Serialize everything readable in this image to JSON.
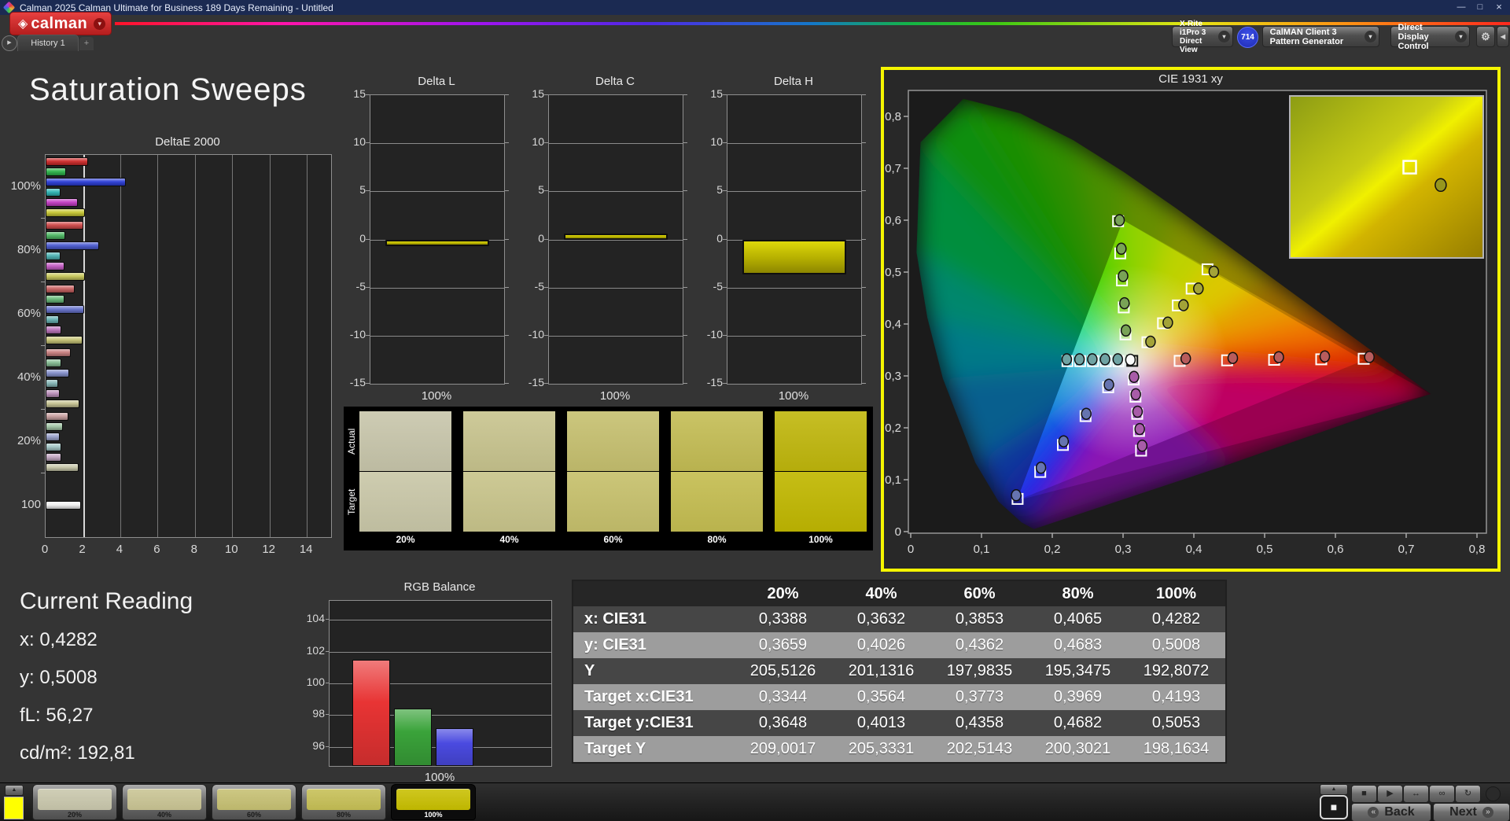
{
  "window": {
    "title": "Calman 2025 Calman Ultimate for Business 189 Days Remaining  - Untitled",
    "minimize": "—",
    "maximize": "□",
    "close": "×"
  },
  "brand": {
    "logo_glyph": "◈",
    "logo_text": "calman",
    "dropdown_glyph": "▾"
  },
  "history_bar": {
    "expand_glyph": "▶",
    "tab_label": "History 1",
    "add_tab_label": "+"
  },
  "toolbar": {
    "meter": {
      "line1": "X-Rite i1Pro 3",
      "line2": "Direct View",
      "stripe_color": "#2ed22e"
    },
    "meter_badge": "714",
    "pattern": {
      "label": "CalMAN Client 3 Pattern Generator",
      "stripe_color": "#2ed22e"
    },
    "display": {
      "label": "Direct Display Control",
      "stripe_color": "#e8e400"
    },
    "gear_glyph": "⚙",
    "collapse_glyph": "◀",
    "dropdown_glyph": "▾"
  },
  "page_title": "Saturation Sweeps",
  "current_reading": {
    "title": "Current Reading",
    "lines": [
      "x: 0,4282",
      "y: 0,5008",
      "fL: 56,27",
      "cd/m²: 192,81"
    ]
  },
  "swatch_panel": {
    "row_labels": [
      "Actual",
      "Target"
    ],
    "columns": [
      {
        "label": "20%",
        "actual": "#c8c6ab",
        "target": "#cac8a9"
      },
      {
        "label": "40%",
        "actual": "#c8c48e",
        "target": "#c9c58c"
      },
      {
        "label": "60%",
        "actual": "#c6c06f",
        "target": "#c7c16d"
      },
      {
        "label": "80%",
        "actual": "#c4bd54",
        "target": "#c5be52"
      },
      {
        "label": "100%",
        "actual": "#c0b70c",
        "target": "#c1b802"
      }
    ]
  },
  "table": {
    "headers": [
      "",
      "20%",
      "40%",
      "60%",
      "80%",
      "100%"
    ],
    "rows": [
      {
        "label": "x: CIE31",
        "values": [
          "0,3388",
          "0,3632",
          "0,3853",
          "0,4065",
          "0,4282"
        ]
      },
      {
        "label": "y: CIE31",
        "values": [
          "0,3659",
          "0,4026",
          "0,4362",
          "0,4683",
          "0,5008"
        ]
      },
      {
        "label": "Y",
        "values": [
          "205,5126",
          "201,1316",
          "197,9835",
          "195,3475",
          "192,8072"
        ]
      },
      {
        "label": "Target x:CIE31",
        "values": [
          "0,3344",
          "0,3564",
          "0,3773",
          "0,3969",
          "0,4193"
        ]
      },
      {
        "label": "Target y:CIE31",
        "values": [
          "0,3648",
          "0,4013",
          "0,4358",
          "0,4682",
          "0,5053"
        ]
      },
      {
        "label": "Target Y",
        "values": [
          "209,0017",
          "205,3331",
          "202,5143",
          "200,3021",
          "198,1634"
        ]
      }
    ]
  },
  "bottom_bar": {
    "up_glyph": "▲",
    "pattern_swatch_color": "#ffff00",
    "swatches": [
      {
        "label": "20%",
        "color": "#c9c7ac",
        "selected": false
      },
      {
        "label": "40%",
        "color": "#c9c493",
        "selected": false
      },
      {
        "label": "60%",
        "color": "#c6c072",
        "selected": false
      },
      {
        "label": "80%",
        "color": "#c6bf55",
        "selected": false
      },
      {
        "label": "100%",
        "color": "#c8bf00",
        "selected": true
      }
    ],
    "transport_buttons": [
      {
        "name": "stop",
        "glyph": "■"
      },
      {
        "name": "play",
        "glyph": "▶"
      },
      {
        "name": "step",
        "glyph": "↔"
      },
      {
        "name": "continuous",
        "glyph": "∞"
      },
      {
        "name": "refresh",
        "glyph": "↻"
      }
    ],
    "stop_button_glyph": "■",
    "back_label": "Back",
    "back_glyph": "«",
    "next_label": "Next",
    "next_glyph": "»"
  },
  "chart_data": [
    {
      "id": "deltae2000",
      "type": "bar",
      "orientation": "horizontal",
      "title": "DeltaE 2000",
      "xlim": [
        0,
        15.3
      ],
      "xticks": [
        0,
        2,
        4,
        6,
        8,
        10,
        12,
        14
      ],
      "reference_line": 2,
      "groups": [
        {
          "label": "100%",
          "bars": [
            {
              "name": "red",
              "value": 2.3,
              "color": "#cf2a2a"
            },
            {
              "name": "green",
              "value": 1.15,
              "color": "#2cb44a"
            },
            {
              "name": "blue",
              "value": 4.35,
              "color": "#2a3cd8"
            },
            {
              "name": "cyan",
              "value": 0.85,
              "color": "#2cb4b4"
            },
            {
              "name": "magenta",
              "value": 1.75,
              "color": "#c43cc4"
            },
            {
              "name": "yellow",
              "value": 2.15,
              "color": "#c8c832"
            }
          ]
        },
        {
          "label": "80%",
          "bars": [
            {
              "name": "red",
              "value": 2.05,
              "color": "#cf4848"
            },
            {
              "name": "green",
              "value": 1.1,
              "color": "#4cb862"
            },
            {
              "name": "blue",
              "value": 2.9,
              "color": "#4a5ad2"
            },
            {
              "name": "cyan",
              "value": 0.85,
              "color": "#4cb4b4"
            },
            {
              "name": "magenta",
              "value": 1.05,
              "color": "#c45cc4"
            },
            {
              "name": "yellow",
              "value": 2.15,
              "color": "#c8c85a"
            }
          ]
        },
        {
          "label": "60%",
          "bars": [
            {
              "name": "red",
              "value": 1.6,
              "color": "#c96060"
            },
            {
              "name": "green",
              "value": 1.05,
              "color": "#66b878"
            },
            {
              "name": "blue",
              "value": 2.1,
              "color": "#6672cc"
            },
            {
              "name": "cyan",
              "value": 0.75,
              "color": "#66b2b2"
            },
            {
              "name": "magenta",
              "value": 0.9,
              "color": "#bc74bc"
            },
            {
              "name": "yellow",
              "value": 2.0,
              "color": "#c6c374"
            }
          ]
        },
        {
          "label": "40%",
          "bars": [
            {
              "name": "red",
              "value": 1.4,
              "color": "#c87e7e"
            },
            {
              "name": "green",
              "value": 0.9,
              "color": "#84bc92"
            },
            {
              "name": "blue",
              "value": 1.3,
              "color": "#8490cc"
            },
            {
              "name": "cyan",
              "value": 0.7,
              "color": "#84b6b6"
            },
            {
              "name": "magenta",
              "value": 0.8,
              "color": "#bc90bc"
            },
            {
              "name": "yellow",
              "value": 1.85,
              "color": "#c6c392"
            }
          ]
        },
        {
          "label": "20%",
          "bars": [
            {
              "name": "red",
              "value": 1.25,
              "color": "#c9a0a0"
            },
            {
              "name": "green",
              "value": 0.95,
              "color": "#a2c6a6"
            },
            {
              "name": "blue",
              "value": 0.8,
              "color": "#9aa2cc"
            },
            {
              "name": "cyan",
              "value": 0.9,
              "color": "#a2c6c6"
            },
            {
              "name": "magenta",
              "value": 0.9,
              "color": "#c2a6c2"
            },
            {
              "name": "yellow",
              "value": 1.8,
              "color": "#c6c6a8"
            }
          ]
        },
        {
          "label": "100",
          "bars": [
            {
              "name": "white",
              "value": 1.95,
              "color": "#f0f0f0"
            }
          ]
        }
      ]
    },
    {
      "id": "delta_l",
      "type": "bar",
      "title": "Delta L",
      "categories": [
        "100%"
      ],
      "values": [
        -0.6
      ],
      "ylim": [
        -15,
        15
      ],
      "yticks": [
        15,
        10,
        5,
        0,
        -5,
        -10,
        -15
      ],
      "xlabel": "100%",
      "bar_color": "#c8c014"
    },
    {
      "id": "delta_c",
      "type": "bar",
      "title": "Delta C",
      "categories": [
        "100%"
      ],
      "values": [
        0.6
      ],
      "ylim": [
        -15,
        15
      ],
      "yticks": [
        15,
        10,
        5,
        0,
        -5,
        -10,
        -15
      ],
      "xlabel": "100%",
      "bar_color": "#c8c014"
    },
    {
      "id": "delta_h",
      "type": "bar",
      "title": "Delta H",
      "categories": [
        "100%"
      ],
      "values": [
        -3.6
      ],
      "ylim": [
        -15,
        15
      ],
      "yticks": [
        15,
        10,
        5,
        0,
        -5,
        -10,
        -15
      ],
      "xlabel": "100%",
      "bar_color": "#c8c014"
    },
    {
      "id": "rgb_balance",
      "type": "bar",
      "title": "RGB Balance",
      "categories": [
        "Red",
        "Green",
        "Blue"
      ],
      "values": [
        101.5,
        98.4,
        97.2
      ],
      "colors": [
        "#e83434",
        "#3aa33a",
        "#4a4ae0"
      ],
      "ylim": [
        94.8,
        105.2
      ],
      "yticks": [
        104,
        102,
        100,
        98,
        96
      ],
      "xlabel": "100%"
    },
    {
      "id": "cie1931",
      "type": "scatter",
      "title": "CIE 1931 xy",
      "xlim": [
        0,
        0.82
      ],
      "ylim": [
        0,
        0.85
      ],
      "tick_values": [
        0,
        0.1,
        0.2,
        0.3,
        0.4,
        0.5,
        0.6,
        0.7,
        0.8
      ],
      "xtick_labels": [
        "0",
        "0,1",
        "0,2",
        "0,3",
        "0,4",
        "0,5",
        "0,6",
        "0,7",
        "0,8"
      ],
      "ytick_labels": [
        "0",
        "0,1",
        "0,2",
        "0,3",
        "0,4",
        "0,5",
        "0,6",
        "0,7",
        "0,8"
      ],
      "gamut_triangle": [
        [
          0.64,
          0.33
        ],
        [
          0.3,
          0.6
        ],
        [
          0.15,
          0.06
        ]
      ],
      "extended_triangle": [
        [
          0.3,
          0.6
        ],
        [
          0.735,
          0.265
        ],
        [
          0.15,
          0.06
        ]
      ],
      "white_point": {
        "target": [
          0.313,
          0.329
        ],
        "measured": [
          0.3105,
          0.331
        ]
      },
      "series": [
        {
          "name": "red",
          "point_color": "#b85c5c",
          "targets": [
            [
              0.38,
              0.329
            ],
            [
              0.447,
              0.33
            ],
            [
              0.5135,
              0.331
            ],
            [
              0.58,
              0.332
            ],
            [
              0.64,
              0.333
            ]
          ],
          "measured": [
            [
              0.3885,
              0.3335
            ],
            [
              0.455,
              0.3345
            ],
            [
              0.52,
              0.336
            ],
            [
              0.585,
              0.3375
            ],
            [
              0.648,
              0.3365
            ]
          ]
        },
        {
          "name": "green",
          "point_color": "#79a356",
          "targets": [
            [
              0.3035,
              0.38
            ],
            [
              0.301,
              0.432
            ],
            [
              0.2985,
              0.484
            ],
            [
              0.296,
              0.536
            ],
            [
              0.293,
              0.598
            ]
          ],
          "measured": [
            [
              0.304,
              0.3875
            ],
            [
              0.302,
              0.44
            ],
            [
              0.3,
              0.4925
            ],
            [
              0.2975,
              0.545
            ],
            [
              0.295,
              0.6
            ]
          ]
        },
        {
          "name": "blue",
          "point_color": "#6674b0",
          "targets": [
            [
              0.279,
              0.278
            ],
            [
              0.247,
              0.2225
            ],
            [
              0.215,
              0.167
            ],
            [
              0.183,
              0.115
            ],
            [
              0.151,
              0.063
            ]
          ],
          "measured": [
            [
              0.28,
              0.283
            ],
            [
              0.248,
              0.227
            ],
            [
              0.216,
              0.174
            ],
            [
              0.184,
              0.123
            ],
            [
              0.149,
              0.07
            ]
          ]
        },
        {
          "name": "cyan",
          "point_color": "#6fa3a3",
          "targets": [
            [
              0.2215,
              0.3285
            ],
            [
              0.2395,
              0.3285
            ],
            [
              0.2575,
              0.3285
            ],
            [
              0.2755,
              0.3285
            ],
            [
              0.2935,
              0.3285
            ]
          ],
          "measured": [
            [
              0.2205,
              0.332
            ],
            [
              0.2385,
              0.332
            ],
            [
              0.2565,
              0.332
            ],
            [
              0.2745,
              0.332
            ],
            [
              0.2925,
              0.332
            ]
          ]
        },
        {
          "name": "magenta",
          "point_color": "#a85ca8",
          "targets": [
            [
              0.315,
              0.293
            ],
            [
              0.3175,
              0.26
            ],
            [
              0.32,
              0.227
            ],
            [
              0.3225,
              0.194
            ],
            [
              0.3255,
              0.156
            ]
          ],
          "measured": [
            [
              0.3155,
              0.298
            ],
            [
              0.318,
              0.2645
            ],
            [
              0.3205,
              0.231
            ],
            [
              0.3235,
              0.1975
            ],
            [
              0.327,
              0.1655
            ]
          ]
        },
        {
          "name": "yellow",
          "point_color": "#a3a338",
          "targets": [
            [
              0.3344,
              0.3648
            ],
            [
              0.3564,
              0.4013
            ],
            [
              0.3773,
              0.4358
            ],
            [
              0.3969,
              0.4682
            ],
            [
              0.4193,
              0.5053
            ]
          ],
          "measured": [
            [
              0.3388,
              0.3659
            ],
            [
              0.3632,
              0.4026
            ],
            [
              0.3853,
              0.4362
            ],
            [
              0.4065,
              0.4683
            ],
            [
              0.4282,
              0.5008
            ]
          ]
        }
      ],
      "inset": {
        "square": [
          0.62,
          0.44
        ],
        "circle": [
          0.78,
          0.55
        ]
      }
    }
  ]
}
